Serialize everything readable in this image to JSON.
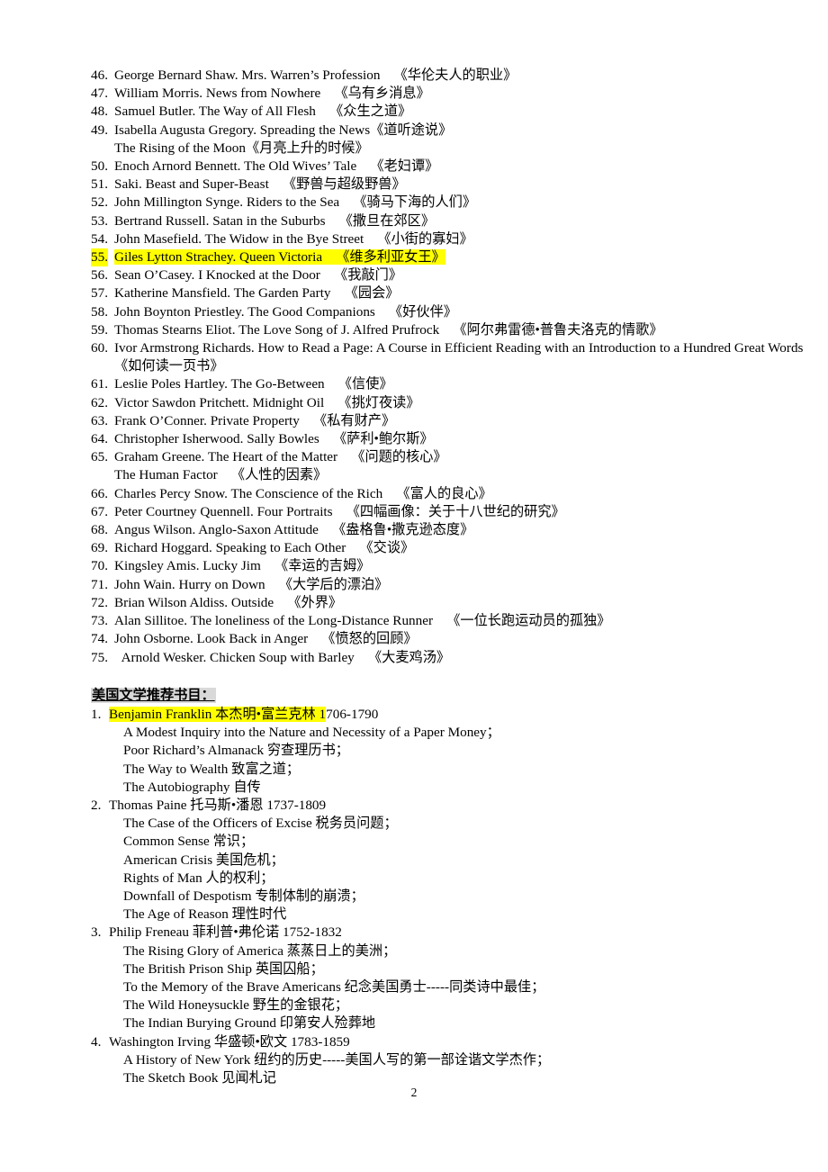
{
  "document": {
    "page_number": "2"
  },
  "british_section": {
    "entries": [
      {
        "num": "46.",
        "lines": [
          {
            "text": "George Bernard Shaw. Mrs. Warren’s Profession 《华伦夫人的职业》"
          }
        ]
      },
      {
        "num": "47.",
        "lines": [
          {
            "text": "William Morris. News from Nowhere 《乌有乡消息》"
          }
        ]
      },
      {
        "num": "48.",
        "lines": [
          {
            "text": "Samuel Butler. The Way of All Flesh 《众生之道》"
          }
        ]
      },
      {
        "num": "49.",
        "lines": [
          {
            "text": "Isabella Augusta Gregory. Spreading the News《道听途说》"
          },
          {
            "text": "The Rising of the Moon《月亮上升的时候》",
            "cont": true
          }
        ]
      },
      {
        "num": "50.",
        "lines": [
          {
            "text": "Enoch Arnord Bennett. The Old Wives’ Tale 《老妇谭》"
          }
        ]
      },
      {
        "num": "51.",
        "lines": [
          {
            "text": "Saki. Beast and Super-Beast 《野兽与超级野兽》"
          }
        ]
      },
      {
        "num": "52.",
        "lines": [
          {
            "text": "John Millington Synge. Riders to the Sea 《骑马下海的人们》"
          }
        ]
      },
      {
        "num": "53.",
        "lines": [
          {
            "text": "Bertrand Russell. Satan in the Suburbs 《撒旦在郊区》"
          }
        ]
      },
      {
        "num": "54.",
        "lines": [
          {
            "text": "John Masefield. The Widow in the Bye Street 《小街的寡妇》"
          }
        ]
      },
      {
        "num": "55.",
        "highlight": "yellow",
        "lines": [
          {
            "text": "Giles Lytton Strachey. Queen Victoria 《维多利亚女王》"
          }
        ]
      },
      {
        "num": "56.",
        "lines": [
          {
            "text": "Sean O’Casey. I Knocked at the Door 《我敲门》"
          }
        ]
      },
      {
        "num": "57.",
        "lines": [
          {
            "text": "Katherine Mansfield. The Garden Party 《园会》"
          }
        ]
      },
      {
        "num": "58.",
        "lines": [
          {
            "text": "John Boynton Priestley. The Good Companions 《好伙伴》"
          }
        ]
      },
      {
        "num": "59.",
        "lines": [
          {
            "text": "Thomas Stearns Eliot. The Love Song of J. Alfred Prufrock 《阿尔弗雷德•普鲁夫洛克的情歌》"
          }
        ]
      },
      {
        "num": "60.",
        "lines": [
          {
            "text": "Ivor Armstrong Richards. How to Read a Page: A Course in Efficient Reading with an Introduction to a Hundred Great Words"
          },
          {
            "text": "《如何读一页书》",
            "cont": true
          }
        ]
      },
      {
        "num": "61.",
        "lines": [
          {
            "text": "Leslie Poles Hartley. The Go-Between 《信使》"
          }
        ]
      },
      {
        "num": "62.",
        "lines": [
          {
            "text": "Victor Sawdon Pritchett. Midnight Oil 《挑灯夜读》"
          }
        ]
      },
      {
        "num": "63.",
        "lines": [
          {
            "text": "Frank O’Conner. Private Property 《私有财产》"
          }
        ]
      },
      {
        "num": "64.",
        "lines": [
          {
            "text": "Christopher Isherwood. Sally Bowles 《萨利•鲍尔斯》"
          }
        ]
      },
      {
        "num": "65.",
        "lines": [
          {
            "text": "Graham Greene. The Heart of the Matter 《问题的核心》"
          },
          {
            "text": "The Human Factor 《人性的因素》",
            "cont": true
          }
        ]
      },
      {
        "num": "66.",
        "lines": [
          {
            "text": "Charles Percy Snow. The Conscience of the Rich 《富人的良心》"
          }
        ]
      },
      {
        "num": "67.",
        "lines": [
          {
            "text": "Peter Courtney Quennell. Four Portraits 《四幅画像：关于十八世纪的研究》"
          }
        ]
      },
      {
        "num": "68.",
        "lines": [
          {
            "text": "Angus Wilson. Anglo-Saxon Attitude 《盎格鲁•撒克逊态度》"
          }
        ]
      },
      {
        "num": "69.",
        "lines": [
          {
            "text": "Richard Hoggard. Speaking to Each Other 《交谈》"
          }
        ]
      },
      {
        "num": "70.",
        "lines": [
          {
            "text": "Kingsley Amis. Lucky Jim 《幸运的吉姆》"
          }
        ]
      },
      {
        "num": "71.",
        "lines": [
          {
            "text": "John Wain. Hurry on Down 《大学后的漂泊》"
          }
        ]
      },
      {
        "num": "72.",
        "lines": [
          {
            "text": "Brian Wilson Aldiss. Outside 《外界》"
          }
        ]
      },
      {
        "num": "73.",
        "lines": [
          {
            "text": "Alan Sillitoe. The loneliness of the Long-Distance Runner 《一位长跑运动员的孤独》"
          }
        ]
      },
      {
        "num": "74.",
        "lines": [
          {
            "text": "John Osborne. Look Back in Anger 《愤怒的回顾》"
          }
        ]
      },
      {
        "num": "75.",
        "lines": [
          {
            "text": " Arnold Wesker. Chicken Soup with Barley 《大麦鸡汤》"
          }
        ]
      }
    ]
  },
  "american_section": {
    "heading": "美国文学推荐书目：",
    "entries": [
      {
        "num": "1.",
        "head_highlighted": "Benjamin Franklin 本杰明•富兰克林 1",
        "head_rest": "706-1790",
        "works": [
          "A Modest Inquiry into the Nature and Necessity of a Paper Money；",
          "Poor Richard’s Almanack 穷查理历书；",
          "The Way to Wealth 致富之道；",
          "The Autobiography 自传"
        ]
      },
      {
        "num": "2.",
        "head": "Thomas Paine 托马斯•潘恩 1737-1809",
        "works": [
          "The Case of the Officers of Excise 税务员问题；",
          "Common Sense 常识；",
          "American Crisis 美国危机；",
          "Rights of Man 人的权利；",
          "Downfall of Despotism 专制体制的崩溃；",
          "The Age of Reason 理性时代"
        ]
      },
      {
        "num": "3.",
        "head": "Philip Freneau 菲利普•弗伦诺 1752-1832",
        "works": [
          "The Rising Glory of America 蒸蒸日上的美洲；",
          "The British Prison Ship 英国囚船；",
          "To the Memory of the Brave Americans 纪念美国勇士-----同类诗中最佳；",
          "The Wild Honeysuckle 野生的金银花；",
          "The Indian Burying Ground 印第安人殓葬地"
        ]
      },
      {
        "num": "4.",
        "head": "Washington Irving 华盛顿•欧文 1783-1859",
        "works": [
          "A History of New York 纽约的历史-----美国人写的第一部诠谐文学杰作；",
          "The Sketch Book 见闻札记"
        ]
      }
    ]
  },
  "colors": {
    "highlight_yellow": "#ffff00",
    "highlight_gray": "#d9d9d9",
    "text": "#000000",
    "background": "#ffffff"
  }
}
